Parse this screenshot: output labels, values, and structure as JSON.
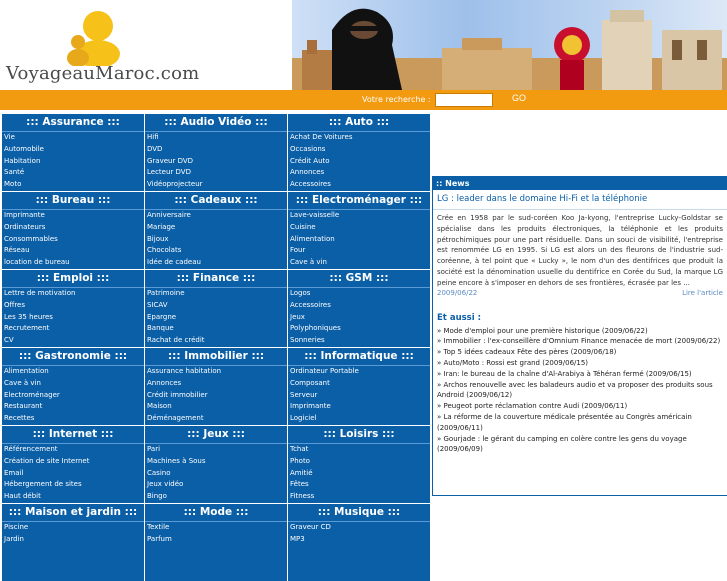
{
  "header": {
    "logo_text": "VoyageauMaroc.com"
  },
  "search": {
    "label": "Votre recherche :",
    "input_value": "",
    "go_label": "GO"
  },
  "categories": [
    {
      "title": "::: Assurance :::",
      "items": [
        "Vie",
        "Automobile",
        "Habitation",
        "Santé",
        "Moto"
      ]
    },
    {
      "title": "::: Audio Vidéo :::",
      "items": [
        "Hifi",
        "DVD",
        "Graveur DVD",
        "Lecteur DVD",
        "Vidéoprojecteur"
      ]
    },
    {
      "title": "::: Auto :::",
      "items": [
        "Achat De Voitures",
        "Occasions",
        "Crédit Auto",
        "Annonces",
        "Accessoires"
      ]
    },
    {
      "title": "::: Bureau :::",
      "items": [
        "Imprimante",
        "Ordinateurs",
        "Consommables",
        "Réseau",
        "location de bureau"
      ]
    },
    {
      "title": "::: Cadeaux :::",
      "items": [
        "Anniversaire",
        "Mariage",
        "Bijoux",
        "Chocolats",
        "Idée de cadeau"
      ]
    },
    {
      "title": "::: Electroménager :::",
      "items": [
        "Lave-vaisselle",
        "Cuisine",
        "Alimentation",
        "Four",
        "Cave à vin"
      ]
    },
    {
      "title": "::: Emploi :::",
      "items": [
        "Lettre de motivation",
        "Offres",
        "Les 35 heures",
        "Recrutement",
        "CV"
      ]
    },
    {
      "title": "::: Finance :::",
      "items": [
        "Patrimoine",
        "SICAV",
        "Epargne",
        "Banque",
        "Rachat de crédit"
      ]
    },
    {
      "title": "::: GSM :::",
      "items": [
        "Logos",
        "Accessoires",
        "Jeux",
        "Polyphoniques",
        "Sonneries"
      ]
    },
    {
      "title": "::: Gastronomie :::",
      "items": [
        "Alimentation",
        "Cave à vin",
        "Electroménager",
        "Restaurant",
        "Recettes"
      ]
    },
    {
      "title": "::: Immobilier :::",
      "items": [
        "Assurance habitation",
        "Annonces",
        "Crédit immobilier",
        "Maison",
        "Déménagement"
      ]
    },
    {
      "title": "::: Informatique :::",
      "items": [
        "Ordinateur Portable",
        "Composant",
        "Serveur",
        "Imprimante",
        "Logiciel"
      ]
    },
    {
      "title": "::: Internet :::",
      "items": [
        "Référencement",
        "Création de site Internet",
        "Email",
        "Hébergement de sites",
        "Haut débit"
      ]
    },
    {
      "title": "::: Jeux :::",
      "items": [
        "Pari",
        "Machines à Sous",
        "Casino",
        "Jeux vidéo",
        "Bingo"
      ]
    },
    {
      "title": "::: Loisirs :::",
      "items": [
        "Tchat",
        "Photo",
        "Amitié",
        "Fêtes",
        "Fitness"
      ]
    },
    {
      "title": "::: Maison et jardin :::",
      "items": [
        "Piscine",
        "Jardin"
      ]
    },
    {
      "title": "::: Mode :::",
      "items": [
        "Textile",
        "Parfum"
      ]
    },
    {
      "title": "::: Musique :::",
      "items": [
        "Graveur CD",
        "MP3"
      ]
    }
  ],
  "news": {
    "header": ":: News",
    "headline": "LG : leader dans le domaine Hi-Fi et la téléphonie",
    "body": "Crée en 1958 par le sud-coréen Koo Ja-kyong, l'entreprise Lucky-Goldstar se spécialise dans les produits électroniques, la téléphonie et les produits pétrochimiques pour une part résiduelle. Dans un souci de visibilité, l'entreprise est renommée LG en 1995. Si LG est alors un des fleurons de l'industrie sud-coréenne, à tel point que « Lucky », le nom d'un des dentifrices que produit la société est la dénomination usuelle du dentifrice en Corée du Sud, la marque LG peine encore à s'imposer en dehors de ses frontières, écrasée par les ...",
    "date": "2009/06/22",
    "more_label": "Lire l'article"
  },
  "aussi": {
    "title": "Et aussi :",
    "items": [
      "» Mode d'emploi pour une première historique (2009/06/22)",
      "» Immobilier : l'ex-conseillère d'Omnium Finance menacée de mort (2009/06/22)",
      "» Top 5 idées cadeaux Fête des pères (2009/06/18)",
      "» Auto/Moto : Rossi est grand (2009/06/15)",
      "» Iran: le bureau de la chaîne d'Al-Arabiya à Téhéran fermé (2009/06/15)",
      "» Archos renouvelle avec les baladeurs audio et va proposer des produits sous Android (2009/06/12)",
      "» Peugeot porte réclamation contre Audi (2009/06/11)",
      "» La réforme de la couverture médicale présentée au Congrès américain (2009/06/11)",
      "» Gourjade : le gérant du camping en colère contre les gens du voyage (2009/06/09)"
    ]
  }
}
